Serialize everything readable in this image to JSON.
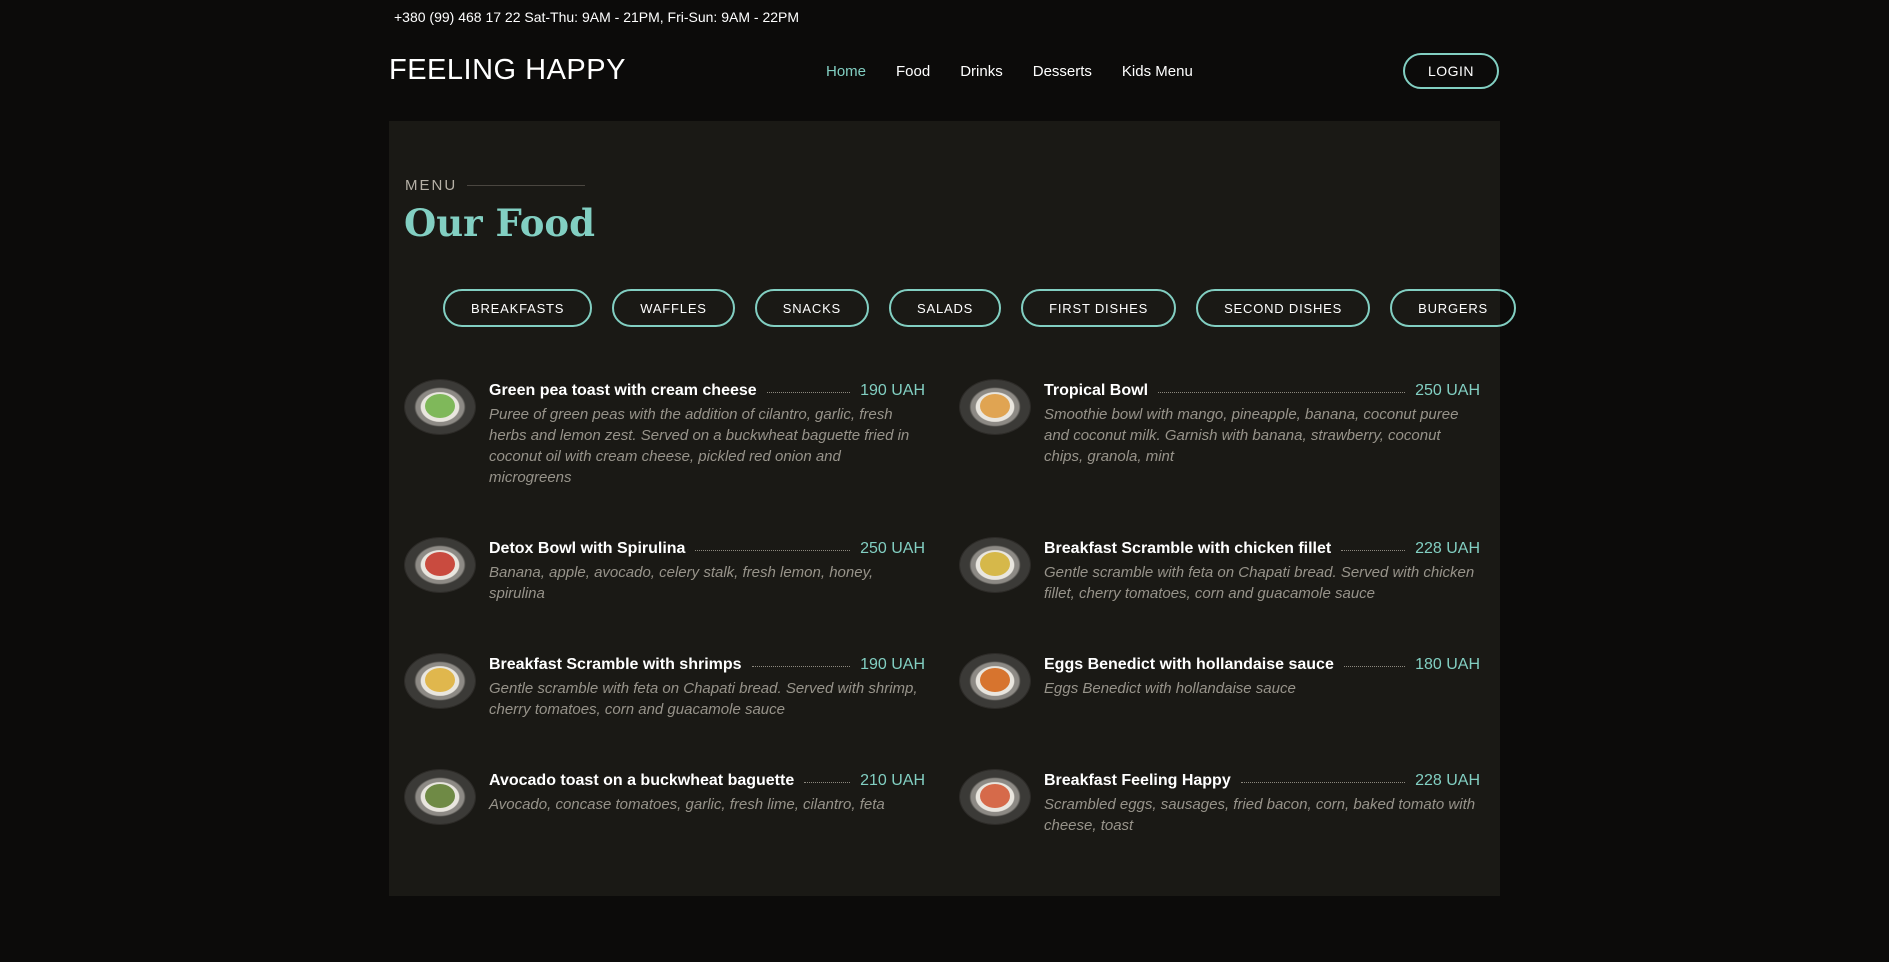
{
  "topbar": {
    "info": "+380 (99) 468 17 22  Sat-Thu: 9AM - 21PM, Fri-Sun: 9AM - 22PM"
  },
  "header": {
    "logo": "FEELING HAPPY",
    "nav": [
      "Home",
      "Food",
      "Drinks",
      "Desserts",
      "Kids Menu"
    ],
    "login_label": "LOGIN"
  },
  "section": {
    "label": "MENU",
    "title": "Our Food"
  },
  "categories": [
    "BREAKFASTS",
    "WAFFLES",
    "SNACKS",
    "SALADS",
    "FIRST DISHES",
    "SECOND DISHES",
    "BURGERS"
  ],
  "items": [
    {
      "name": "Green pea toast with cream cheese",
      "price": "190 UAH",
      "desc": "Puree of green peas with the addition of cilantro, garlic, fresh herbs and lemon zest. Served on a buckwheat baguette fried in coconut oil with cream cheese, pickled red onion and microgreens"
    },
    {
      "name": "Tropical Bowl",
      "price": "250 UAH",
      "desc": "Smoothie bowl with mango, pineapple, banana, coconut puree and coconut milk. Garnish with banana, strawberry, coconut chips, granola, mint"
    },
    {
      "name": "Detox Bowl with Spirulina",
      "price": "250 UAH",
      "desc": "Banana, apple, avocado, celery stalk, fresh lemon, honey, spirulina"
    },
    {
      "name": "Breakfast Scramble with chicken fillet",
      "price": "228 UAH",
      "desc": "Gentle scramble with feta on Chapati bread. Served with chicken fillet, cherry tomatoes, corn and guacamole sauce"
    },
    {
      "name": "Breakfast Scramble with shrimps",
      "price": "190 UAH",
      "desc": "Gentle scramble with feta on Chapati bread. Served with shrimp, cherry tomatoes, corn and guacamole sauce"
    },
    {
      "name": "Eggs Benedict with hollandaise sauce",
      "price": "180 UAH",
      "desc": "Eggs Benedict with hollandaise sauce"
    },
    {
      "name": "Avocado toast on a buckwheat baguette",
      "price": "210 UAH",
      "desc": "Avocado, concase tomatoes, garlic, fresh lime, cilantro, feta"
    },
    {
      "name": "Breakfast Feeling Happy",
      "price": "228 UAH",
      "desc": "Scrambled eggs, sausages, fried bacon, corn, baked tomato with cheese, toast"
    }
  ],
  "colors": {
    "accent": "#82cfc2",
    "background": "#0c0b0a",
    "panel": "#1a1915"
  }
}
